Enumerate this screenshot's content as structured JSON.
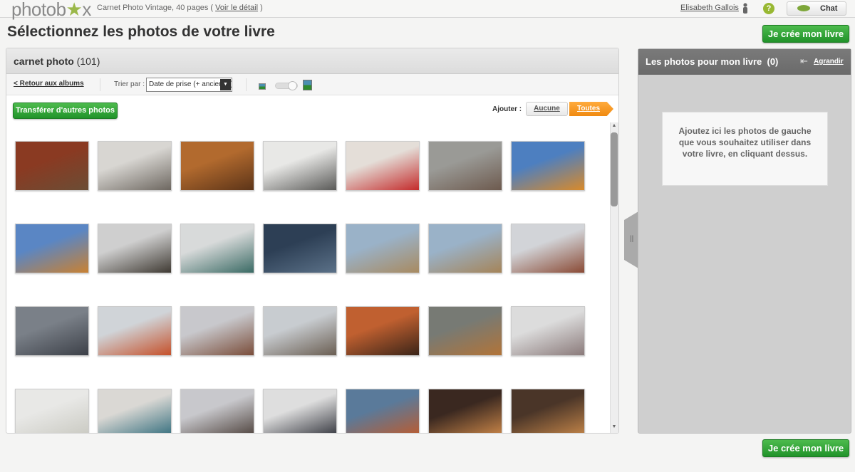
{
  "topbar": {
    "logo": "photobox",
    "product": "Carnet Photo Vintage, 40 pages",
    "detail_link": "Voir le détail",
    "user": "Elisabeth Gallois",
    "help": "?",
    "chat": "Chat"
  },
  "page_title": "Sélectionnez les photos de votre livre",
  "create_button": "Je crée mon livre",
  "album": {
    "name": "carnet photo",
    "count": "(101)",
    "back": "< Retour aux albums",
    "sort_label": "Trier par :",
    "sort_value": "Date de prise (+ ancienne)",
    "transfer": "Transférer d'autres photos",
    "add_label": "Ajouter :",
    "add_none": "Aucune",
    "add_all": "Toutes"
  },
  "photos": [
    [
      "#8a3a22",
      "#6b4d35"
    ],
    [
      "#d8d6d2",
      "#6d6760"
    ],
    [
      "#b26a2e",
      "#5c3418"
    ],
    [
      "#e8e8e6",
      "#5a5a58"
    ],
    [
      "#e4ded8",
      "#c42b2b"
    ],
    [
      "#9a9a96",
      "#6d5a4e"
    ],
    [
      "#4d7fc0",
      "#d98a2a"
    ],
    [
      "#5a86c4",
      "#c98132"
    ],
    [
      "#cfcfcf",
      "#3f3a33"
    ],
    [
      "#d8dada",
      "#3a6a64"
    ],
    [
      "#2d3f55",
      "#5b7188"
    ],
    [
      "#9ab2c8",
      "#a88a60"
    ],
    [
      "#9ab2c8",
      "#a58458"
    ],
    [
      "#d2d4d8",
      "#8a4a35"
    ],
    [
      "#7a8088",
      "#3c4048"
    ],
    [
      "#d0d4d8",
      "#c5502a"
    ],
    [
      "#c8c8cc",
      "#7a4d3a"
    ],
    [
      "#c8ccd0",
      "#6a5e52"
    ],
    [
      "#c06030",
      "#3a2418"
    ],
    [
      "#777a74",
      "#b27438"
    ],
    [
      "#dcdcdc",
      "#8a7a7a"
    ],
    [
      "#e8e8e6",
      "#c8c8c0"
    ],
    [
      "#dad8d4",
      "#2e6a7a"
    ],
    [
      "#c8c8cc",
      "#4a3e38"
    ],
    [
      "#dedede",
      "#2e3038"
    ],
    [
      "#5a7a9a",
      "#c05a2a"
    ],
    [
      "#3a2820",
      "#d08a4a"
    ],
    [
      "#4a3528",
      "#c8884a"
    ]
  ],
  "panel": {
    "title": "Les photos pour mon livre",
    "count": "(0)",
    "expand": "Agrandir",
    "hint": "Ajoutez ici les photos de gauche que vous souhaitez utiliser dans votre livre, en cliquant dessus."
  }
}
